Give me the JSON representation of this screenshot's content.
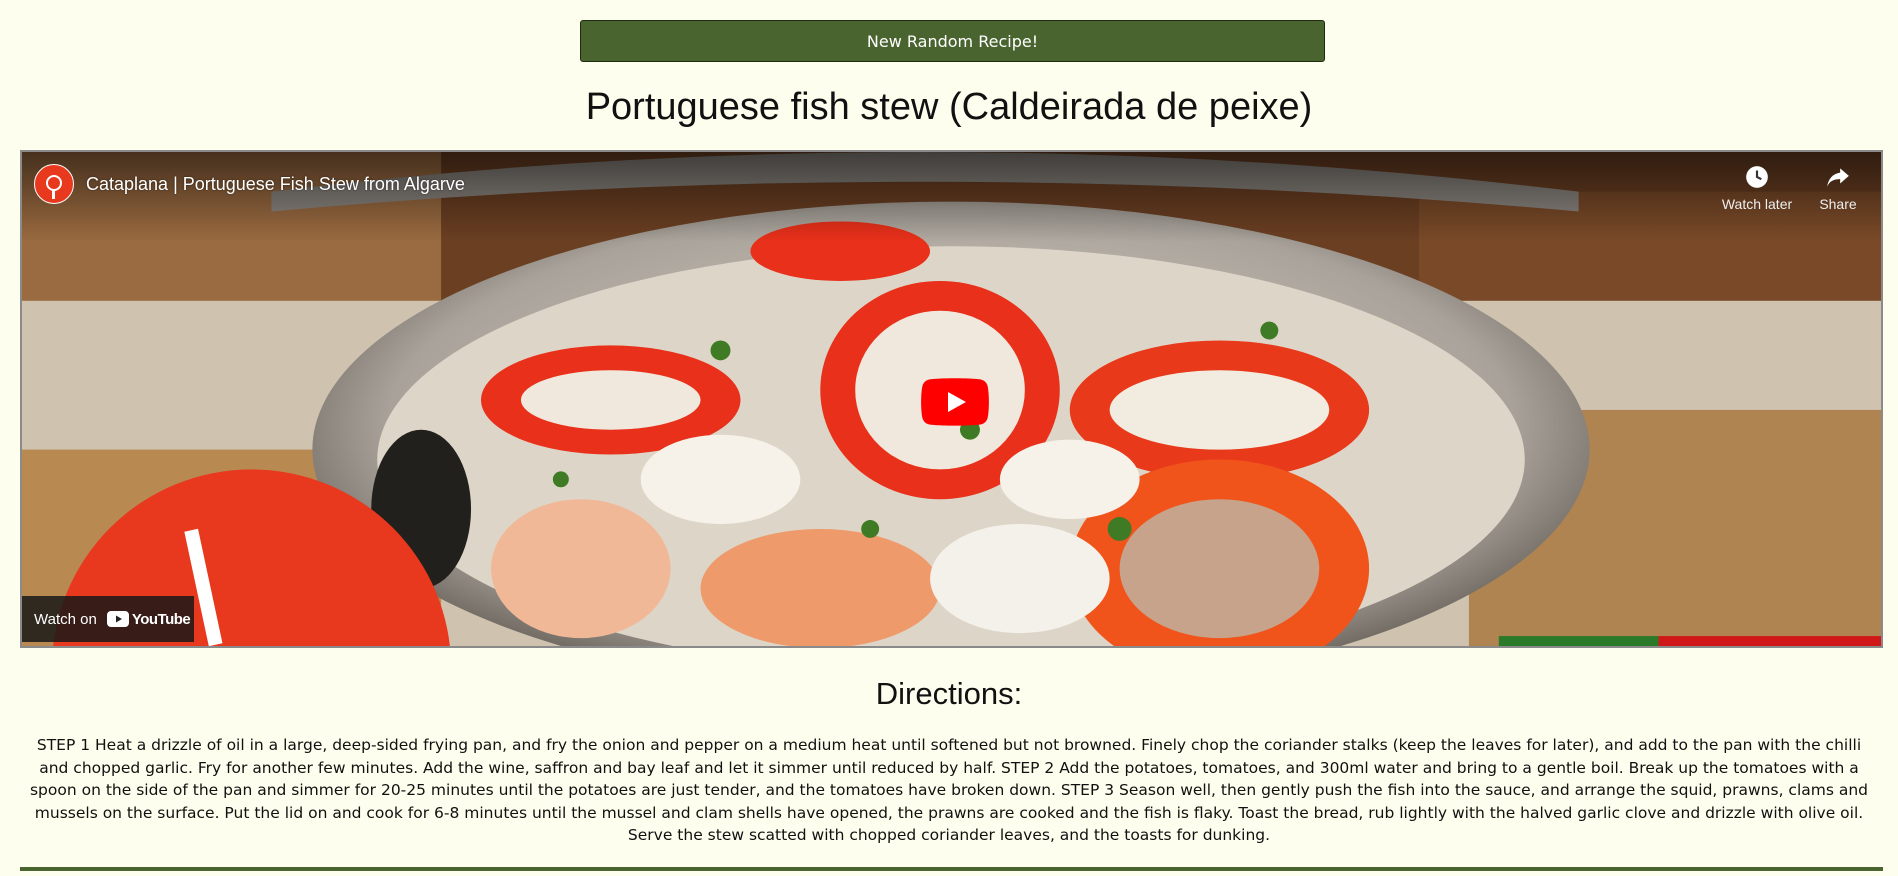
{
  "toolbar": {
    "random_button_label": "New Random Recipe!"
  },
  "recipe": {
    "title": "Portuguese fish stew (Caldeirada de peixe)",
    "directions_heading": "Directions:",
    "directions_text": "STEP 1 Heat a drizzle of oil in a large, deep-sided frying pan, and fry the onion and pepper on a medium heat until softened but not browned. Finely chop the coriander stalks (keep the leaves for later), and add to the pan with the chilli and chopped garlic. Fry for another few minutes. Add the wine, saffron and bay leaf and let it simmer until reduced by half. STEP 2 Add the potatoes, tomatoes, and 300ml water and bring to a gentle boil. Break up the tomatoes with a spoon on the side of the pan and simmer for 20-25 minutes until the potatoes are just tender, and the tomatoes have broken down. STEP 3 Season well, then gently push the fish into the sauce, and arrange the squid, prawns, clams and mussels on the surface. Put the lid on and cook for 6-8 minutes until the mussel and clam shells have opened, the prawns are cooked and the fish is flaky. Toast the bread, rub lightly with the halved garlic clove and drizzle with olive oil. Serve the stew scatted with chopped coriander leaves, and the toasts for dunking."
  },
  "video": {
    "title": "Cataplana | Portuguese Fish Stew from Algarve",
    "watch_later_label": "Watch later",
    "share_label": "Share",
    "watch_on_label": "Watch on",
    "youtube_logo_text": "YouTube",
    "icons": {
      "channel": "channel-avatar-icon",
      "watch_later": "clock-icon",
      "share": "share-arrow-icon",
      "play": "play-icon"
    }
  },
  "colors": {
    "page_background": "#fefeee",
    "accent_green": "#4a6430",
    "youtube_red": "#ff0000"
  }
}
